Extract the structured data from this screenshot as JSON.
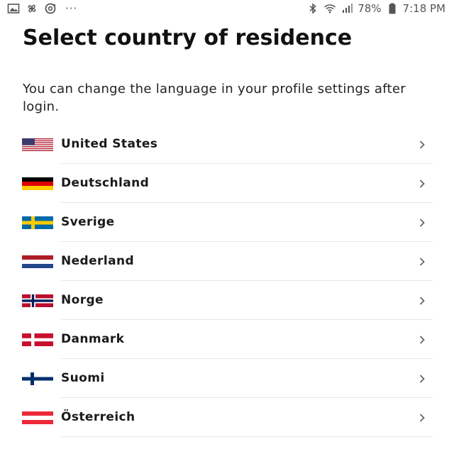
{
  "status_bar": {
    "left_icons": [
      "image-icon",
      "pinwheel-icon",
      "sync-icon"
    ],
    "overflow": "···",
    "right_icons": [
      "bluetooth-icon",
      "wifi-icon",
      "signal-icon"
    ],
    "battery_percent": "78%",
    "time": "7:18 PM"
  },
  "header": {
    "title": "Select country of residence",
    "subtitle": "You can change the language in your profile settings after login."
  },
  "countries": [
    {
      "name": "United States",
      "flag": "us-flag-icon"
    },
    {
      "name": "Deutschland",
      "flag": "de-flag-icon"
    },
    {
      "name": "Sverige",
      "flag": "se-flag-icon"
    },
    {
      "name": "Nederland",
      "flag": "nl-flag-icon"
    },
    {
      "name": "Norge",
      "flag": "no-flag-icon"
    },
    {
      "name": "Danmark",
      "flag": "dk-flag-icon"
    },
    {
      "name": "Suomi",
      "flag": "fi-flag-icon"
    },
    {
      "name": "Österreich",
      "flag": "at-flag-icon"
    }
  ],
  "colors": {
    "us_red": "#b22234",
    "us_blue": "#3c3b6e",
    "de_black": "#000000",
    "de_red": "#dd0000",
    "de_gold": "#ffce00",
    "se_blue": "#006aa7",
    "se_yellow": "#fecc00",
    "nl_red": "#ae1c28",
    "nl_blue": "#21468b",
    "no_red": "#ba0c2f",
    "no_blue": "#00205b",
    "dk_red": "#c8102e",
    "fi_blue": "#002f6c",
    "at_red": "#ed2939",
    "divider": "#e6e6e6",
    "chevron": "#666666"
  }
}
